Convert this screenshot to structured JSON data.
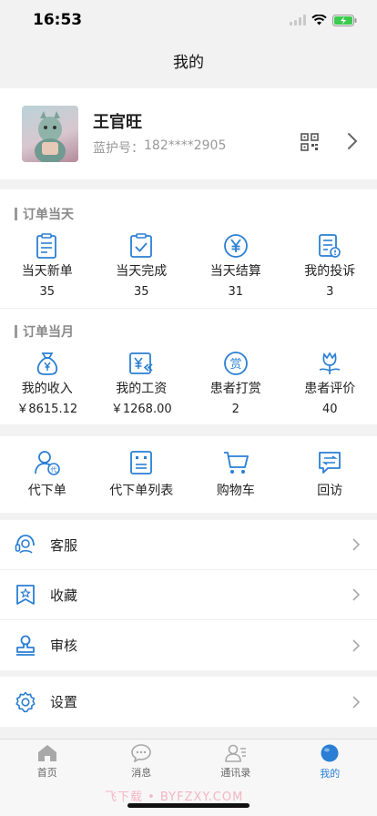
{
  "status": {
    "time": "16:53"
  },
  "nav": {
    "title": "我的"
  },
  "profile": {
    "name": "王官旺",
    "phone_label": "蓝护号：",
    "phone": "182****2905"
  },
  "daily": {
    "title": "订单当天",
    "items": [
      {
        "label": "当天新单",
        "value": "35",
        "icon": "clipboard-list-icon"
      },
      {
        "label": "当天完成",
        "value": "35",
        "icon": "clipboard-check-icon"
      },
      {
        "label": "当天结算",
        "value": "31",
        "icon": "yen-circle-icon"
      },
      {
        "label": "我的投诉",
        "value": "3",
        "icon": "complaint-doc-icon"
      }
    ]
  },
  "monthly": {
    "title": "订单当月",
    "items": [
      {
        "label": "我的收入",
        "value": "￥8615.12",
        "icon": "money-bag-icon"
      },
      {
        "label": "我的工资",
        "value": "￥1268.00",
        "icon": "salary-card-icon"
      },
      {
        "label": "患者打赏",
        "value": "2",
        "icon": "reward-icon"
      },
      {
        "label": "患者评价",
        "value": "40",
        "icon": "flower-icon"
      }
    ]
  },
  "tools": [
    {
      "label": "代下单",
      "icon": "proxy-order-icon"
    },
    {
      "label": "代下单列表",
      "icon": "order-list-icon"
    },
    {
      "label": "购物车",
      "icon": "cart-icon"
    },
    {
      "label": "回访",
      "icon": "follow-up-icon"
    }
  ],
  "menu": {
    "service": "客服",
    "favorites": "收藏",
    "review": "审核",
    "settings": "设置"
  },
  "tabs": [
    {
      "label": "首页",
      "icon": "home-icon"
    },
    {
      "label": "消息",
      "icon": "message-icon"
    },
    {
      "label": "通讯录",
      "icon": "contacts-icon"
    },
    {
      "label": "我的",
      "icon": "profile-icon",
      "active": true
    }
  ],
  "colors": {
    "accent": "#2a7fd4",
    "gray_icon": "#9a9a9a"
  },
  "watermark": "飞下载 • BYFZXY.COM"
}
